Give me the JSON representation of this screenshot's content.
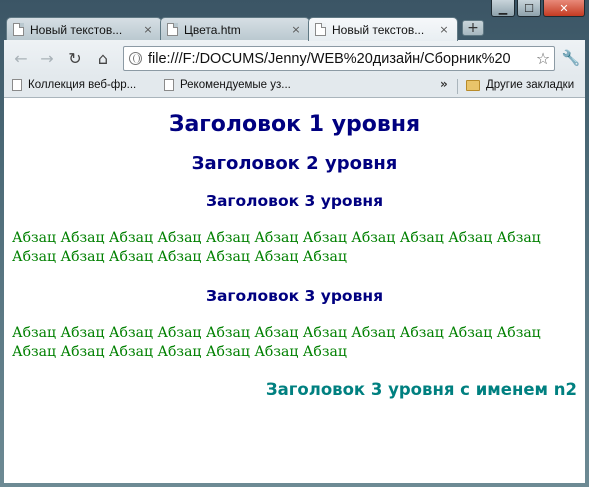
{
  "window": {
    "controls": {
      "minimize": "▁",
      "maximize": "☐",
      "close": "✕"
    }
  },
  "tabs": [
    {
      "title": "Новый текстов...",
      "active": false,
      "icon": "document-icon",
      "close": "×"
    },
    {
      "title": "Цвета.htm",
      "active": false,
      "icon": "document-icon",
      "close": "×"
    },
    {
      "title": "Новый текстов...",
      "active": true,
      "icon": "document-icon",
      "close": "×"
    }
  ],
  "new_tab": "+",
  "toolbar": {
    "back": "←",
    "forward": "→",
    "reload": "↻",
    "home": "⌂",
    "url": "file:///F:/DOCUMS/Jenny/WEB%20дизайн/Сборник%20",
    "star": "☆",
    "wrench": "🔧"
  },
  "bookmarks": {
    "items": [
      {
        "label": "Коллекция веб-фр...",
        "icon": "document-icon"
      },
      {
        "label": "Рекомендуемые уз...",
        "icon": "document-icon"
      }
    ],
    "overflow": "»",
    "other": {
      "label": "Другие закладки",
      "icon": "folder-icon"
    }
  },
  "page": {
    "h1": "Заголовок 1 уровня",
    "h2": "Заголовок 2 уровня",
    "h3_first": "Заголовок 3 уровня",
    "paragraph1": "Абзац Абзац Абзац Абзац Абзац Абзац Абзац Абзац Абзац Абзац Абзац Абзац Абзац Абзац Абзац Абзац Абзац Абзац",
    "h3_second": "Заголовок 3 уровня",
    "paragraph2": "Абзац Абзац Абзац Абзац Абзац Абзац Абзац Абзац Абзац Абзац Абзац Абзац Абзац Абзац Абзац Абзац Абзац Абзац",
    "h3_named": "Заголовок 3 уровня с именем n2",
    "colors": {
      "heading": "#000080",
      "paragraph": "#008000",
      "named_heading": "#008080"
    }
  }
}
